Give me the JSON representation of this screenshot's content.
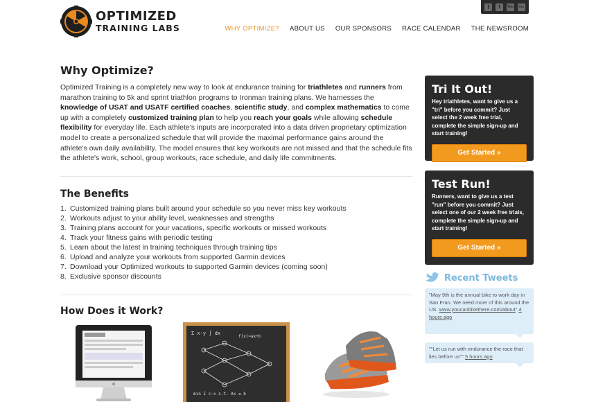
{
  "brand": {
    "line1": "OPTIMIZED",
    "line2": "TRAINING LABS"
  },
  "social": [
    "f",
    "t",
    "You",
    "rss"
  ],
  "nav": [
    {
      "label": "WHY OPTIMIZE?",
      "active": true
    },
    {
      "label": "ABOUT US"
    },
    {
      "label": "OUR SPONSORS"
    },
    {
      "label": "RACE CALENDAR"
    },
    {
      "label": "THE NEWSROOM"
    }
  ],
  "main": {
    "title": "Why Optimize?",
    "intro_html": "Optimized Training is a completely new way to look at endurance training for <b>triathletes</b> and <b>runners</b> from marathon training to 5k and sprint triathlon programs to Ironman training plans. We harnesses the <b>knowledge of USAT and USATF certified coaches</b>, <b>scientific study</b>, and <b>complex mathematics</b> to come up with a completely <b>customized training plan</b> to help you <b>reach your goals</b> while allowing <b>schedule flexibility</b> for everyday life. Each athlete's inputs are incorporated into a data driven proprietary optimization model to create a personalized schedule that will provide the maximal performance gains around the athlete's own daily availability. The model ensures that key workouts are not missed and that the schedule fits the athlete's work, school, group workouts, race schedule, and daily life commitments.",
    "benefits_title": "The Benefits",
    "benefits": [
      "Customized training plans built around your schedule so you never miss key workouts",
      "Workouts adjust to your ability level, weaknesses and strengths",
      "Training plans account for your vacations, specific workouts or missed workouts",
      "Track your fitness gains with periodic testing",
      "Learn about the latest in training techniques through training tips",
      "Upload and analyze your workouts from supported Garmin devices",
      "Download your Optimized workouts to supported Garmin devices (coming soon)",
      "Exclusive sponsor discounts"
    ],
    "how_title": "How Does it Work?"
  },
  "sidebar": {
    "tri": {
      "title": "Tri It Out!",
      "text": "Hey triathletes, want to give us a \"tri\" before you commit? Just select the 2 week free trial, complete the simple sign-up and start training!",
      "button": "Get Started »"
    },
    "run": {
      "title": "Test Run!",
      "text": "Runners, want to give us a test \"run\" before you commit? Just select one of our 2 week free trials, complete the simple sign-up and start training!",
      "button": "Get Started »"
    },
    "tweets_title": "Recent Tweets",
    "tweets": [
      {
        "text": "\"May 9th is the annual bike to work day in San Fran. We need more of this around the US.",
        "link": "www.youcanbikethere.com/about",
        "tail": "\" ",
        "time": "4 hours ago"
      },
      {
        "text": "\"\"Let us run with endurance the race that lies before us\"\" ",
        "link": "",
        "tail": "",
        "time": "5 hours ago"
      }
    ]
  },
  "colors": {
    "accent": "#e8922a",
    "button": "#f29a1e",
    "promo_bg": "#2b2b2b",
    "tweet_bg": "#ddeef8",
    "tweet_head": "#7db8dd"
  }
}
